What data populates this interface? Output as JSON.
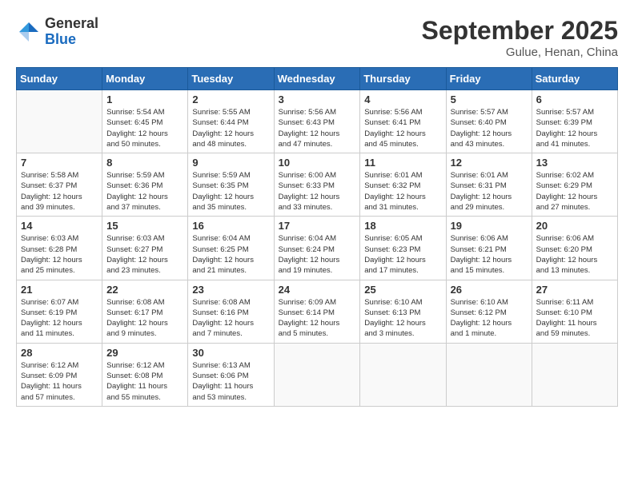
{
  "logo": {
    "general": "General",
    "blue": "Blue"
  },
  "title": "September 2025",
  "subtitle": "Gulue, Henan, China",
  "days_header": [
    "Sunday",
    "Monday",
    "Tuesday",
    "Wednesday",
    "Thursday",
    "Friday",
    "Saturday"
  ],
  "weeks": [
    [
      {
        "day": "",
        "info": ""
      },
      {
        "day": "1",
        "info": "Sunrise: 5:54 AM\nSunset: 6:45 PM\nDaylight: 12 hours\nand 50 minutes."
      },
      {
        "day": "2",
        "info": "Sunrise: 5:55 AM\nSunset: 6:44 PM\nDaylight: 12 hours\nand 48 minutes."
      },
      {
        "day": "3",
        "info": "Sunrise: 5:56 AM\nSunset: 6:43 PM\nDaylight: 12 hours\nand 47 minutes."
      },
      {
        "day": "4",
        "info": "Sunrise: 5:56 AM\nSunset: 6:41 PM\nDaylight: 12 hours\nand 45 minutes."
      },
      {
        "day": "5",
        "info": "Sunrise: 5:57 AM\nSunset: 6:40 PM\nDaylight: 12 hours\nand 43 minutes."
      },
      {
        "day": "6",
        "info": "Sunrise: 5:57 AM\nSunset: 6:39 PM\nDaylight: 12 hours\nand 41 minutes."
      }
    ],
    [
      {
        "day": "7",
        "info": "Sunrise: 5:58 AM\nSunset: 6:37 PM\nDaylight: 12 hours\nand 39 minutes."
      },
      {
        "day": "8",
        "info": "Sunrise: 5:59 AM\nSunset: 6:36 PM\nDaylight: 12 hours\nand 37 minutes."
      },
      {
        "day": "9",
        "info": "Sunrise: 5:59 AM\nSunset: 6:35 PM\nDaylight: 12 hours\nand 35 minutes."
      },
      {
        "day": "10",
        "info": "Sunrise: 6:00 AM\nSunset: 6:33 PM\nDaylight: 12 hours\nand 33 minutes."
      },
      {
        "day": "11",
        "info": "Sunrise: 6:01 AM\nSunset: 6:32 PM\nDaylight: 12 hours\nand 31 minutes."
      },
      {
        "day": "12",
        "info": "Sunrise: 6:01 AM\nSunset: 6:31 PM\nDaylight: 12 hours\nand 29 minutes."
      },
      {
        "day": "13",
        "info": "Sunrise: 6:02 AM\nSunset: 6:29 PM\nDaylight: 12 hours\nand 27 minutes."
      }
    ],
    [
      {
        "day": "14",
        "info": "Sunrise: 6:03 AM\nSunset: 6:28 PM\nDaylight: 12 hours\nand 25 minutes."
      },
      {
        "day": "15",
        "info": "Sunrise: 6:03 AM\nSunset: 6:27 PM\nDaylight: 12 hours\nand 23 minutes."
      },
      {
        "day": "16",
        "info": "Sunrise: 6:04 AM\nSunset: 6:25 PM\nDaylight: 12 hours\nand 21 minutes."
      },
      {
        "day": "17",
        "info": "Sunrise: 6:04 AM\nSunset: 6:24 PM\nDaylight: 12 hours\nand 19 minutes."
      },
      {
        "day": "18",
        "info": "Sunrise: 6:05 AM\nSunset: 6:23 PM\nDaylight: 12 hours\nand 17 minutes."
      },
      {
        "day": "19",
        "info": "Sunrise: 6:06 AM\nSunset: 6:21 PM\nDaylight: 12 hours\nand 15 minutes."
      },
      {
        "day": "20",
        "info": "Sunrise: 6:06 AM\nSunset: 6:20 PM\nDaylight: 12 hours\nand 13 minutes."
      }
    ],
    [
      {
        "day": "21",
        "info": "Sunrise: 6:07 AM\nSunset: 6:19 PM\nDaylight: 12 hours\nand 11 minutes."
      },
      {
        "day": "22",
        "info": "Sunrise: 6:08 AM\nSunset: 6:17 PM\nDaylight: 12 hours\nand 9 minutes."
      },
      {
        "day": "23",
        "info": "Sunrise: 6:08 AM\nSunset: 6:16 PM\nDaylight: 12 hours\nand 7 minutes."
      },
      {
        "day": "24",
        "info": "Sunrise: 6:09 AM\nSunset: 6:14 PM\nDaylight: 12 hours\nand 5 minutes."
      },
      {
        "day": "25",
        "info": "Sunrise: 6:10 AM\nSunset: 6:13 PM\nDaylight: 12 hours\nand 3 minutes."
      },
      {
        "day": "26",
        "info": "Sunrise: 6:10 AM\nSunset: 6:12 PM\nDaylight: 12 hours\nand 1 minute."
      },
      {
        "day": "27",
        "info": "Sunrise: 6:11 AM\nSunset: 6:10 PM\nDaylight: 11 hours\nand 59 minutes."
      }
    ],
    [
      {
        "day": "28",
        "info": "Sunrise: 6:12 AM\nSunset: 6:09 PM\nDaylight: 11 hours\nand 57 minutes."
      },
      {
        "day": "29",
        "info": "Sunrise: 6:12 AM\nSunset: 6:08 PM\nDaylight: 11 hours\nand 55 minutes."
      },
      {
        "day": "30",
        "info": "Sunrise: 6:13 AM\nSunset: 6:06 PM\nDaylight: 11 hours\nand 53 minutes."
      },
      {
        "day": "",
        "info": ""
      },
      {
        "day": "",
        "info": ""
      },
      {
        "day": "",
        "info": ""
      },
      {
        "day": "",
        "info": ""
      }
    ]
  ]
}
